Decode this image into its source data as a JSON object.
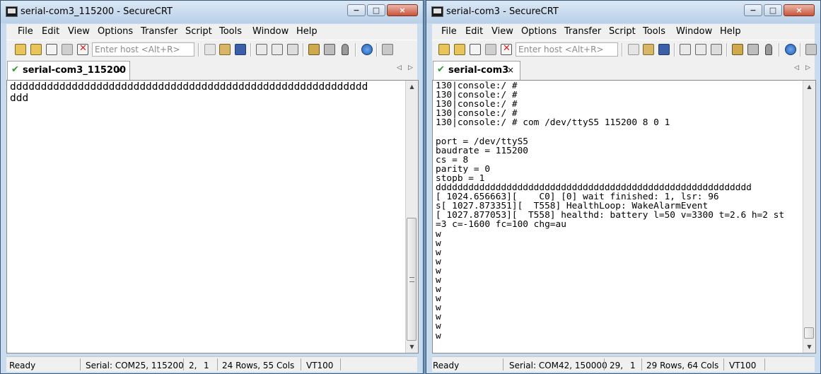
{
  "left": {
    "title": "serial-com3_115200 - SecureCRT",
    "menu": [
      "File",
      "Edit",
      "View",
      "Options",
      "Transfer",
      "Script",
      "Tools",
      "Window",
      "Help"
    ],
    "host_placeholder": "Enter host <Alt+R>",
    "tab_label": "serial-com3_115200",
    "tab_close": "×",
    "terminal_text": "dddddddddddddddddddddddddddddddddddddddddddddddddddddddddd\nddd",
    "status": {
      "ready": "Ready",
      "serial": "Serial: COM25, 115200",
      "pos_row": "2,",
      "pos_col": "1",
      "size": "24 Rows, 55 Cols",
      "emulation": "VT100"
    }
  },
  "right": {
    "title": "serial-com3 - SecureCRT",
    "menu": [
      "File",
      "Edit",
      "View",
      "Options",
      "Transfer",
      "Script",
      "Tools",
      "Window",
      "Help"
    ],
    "host_placeholder": "Enter host <Alt+R>",
    "tab_label": "serial-com3",
    "tab_close": "×",
    "terminal_text": "130|console:/ #\n130|console:/ #\n130|console:/ #\n130|console:/ #\n130|console:/ # com /dev/ttyS5 115200 8 0 1\n\nport = /dev/ttyS5\nbaudrate = 115200\ncs = 8\nparity = 0\nstopb = 1\ndddddddddddddddddddddddddddddddddddddddddddddddddddddddddd\n[ 1024.656663][    C0] [0] wait finished: 1, lsr: 96\ns[ 1027.873351][  T558] HealthLoop: WakeAlarmEvent\n[ 1027.877053][  T558] healthd: battery l=50 v=3300 t=2.6 h=2 st\n=3 c=-1600 fc=100 chg=au\nw\nw\nw\nw\nw\nw\nw\nw\nw\nw\nw\nw",
    "status": {
      "ready": "Ready",
      "serial": "Serial: COM42, 150000",
      "pos_row": "29,",
      "pos_col": "1",
      "size": "29 Rows, 64 Cols",
      "emulation": "VT100"
    }
  },
  "window_buttons": {
    "minimize": "−",
    "maximize": "□",
    "close": "×"
  },
  "scroll_arrows": {
    "up": "▲",
    "down": "▼",
    "tab_prev": "◁",
    "tab_next": "▷"
  },
  "tab_check": "✔",
  "icons": [
    "connect-icon",
    "quick-connect-icon",
    "connect-tab-icon",
    "reconnect-icon",
    "disconnect-icon",
    "copy-icon",
    "paste-icon",
    "find-icon",
    "print-screen-icon",
    "print-selection-icon",
    "print-icon",
    "session-options-icon",
    "global-options-icon",
    "keymap-icon",
    "help-icon",
    "sftp-icon"
  ]
}
